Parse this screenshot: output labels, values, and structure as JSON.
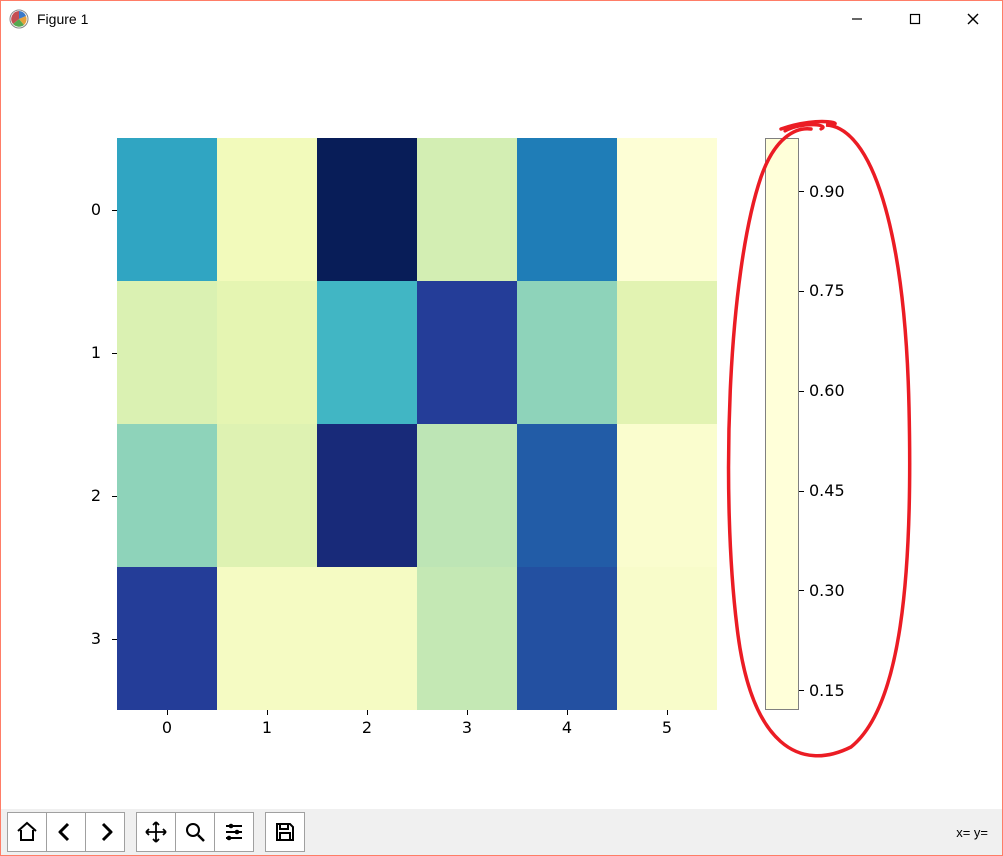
{
  "window": {
    "title": "Figure 1"
  },
  "chart_data": {
    "type": "heatmap",
    "x_categories": [
      "0",
      "1",
      "2",
      "3",
      "4",
      "5"
    ],
    "y_categories": [
      "0",
      "1",
      "2",
      "3"
    ],
    "values": [
      [
        0.6,
        0.2,
        0.98,
        0.3,
        0.7,
        0.13
      ],
      [
        0.28,
        0.25,
        0.55,
        0.85,
        0.42,
        0.26
      ],
      [
        0.42,
        0.27,
        0.92,
        0.35,
        0.77,
        0.15
      ],
      [
        0.85,
        0.18,
        0.18,
        0.34,
        0.8,
        0.16
      ]
    ],
    "colorbar_ticks": [
      "0.15",
      "0.30",
      "0.45",
      "0.60",
      "0.75",
      "0.90"
    ],
    "colorbar_range": [
      0.12,
      0.98
    ],
    "colormap": "YlGnBu",
    "xlabel": "",
    "ylabel": "",
    "title": ""
  },
  "annotation": {
    "description": "hand-drawn red circle around the colorbar"
  },
  "toolbar": {
    "home": "Home",
    "back": "Back",
    "forward": "Forward",
    "pan": "Pan",
    "zoom": "Zoom",
    "configure": "Configure subplots",
    "save": "Save"
  },
  "status": {
    "coord_readout": "x= y="
  }
}
